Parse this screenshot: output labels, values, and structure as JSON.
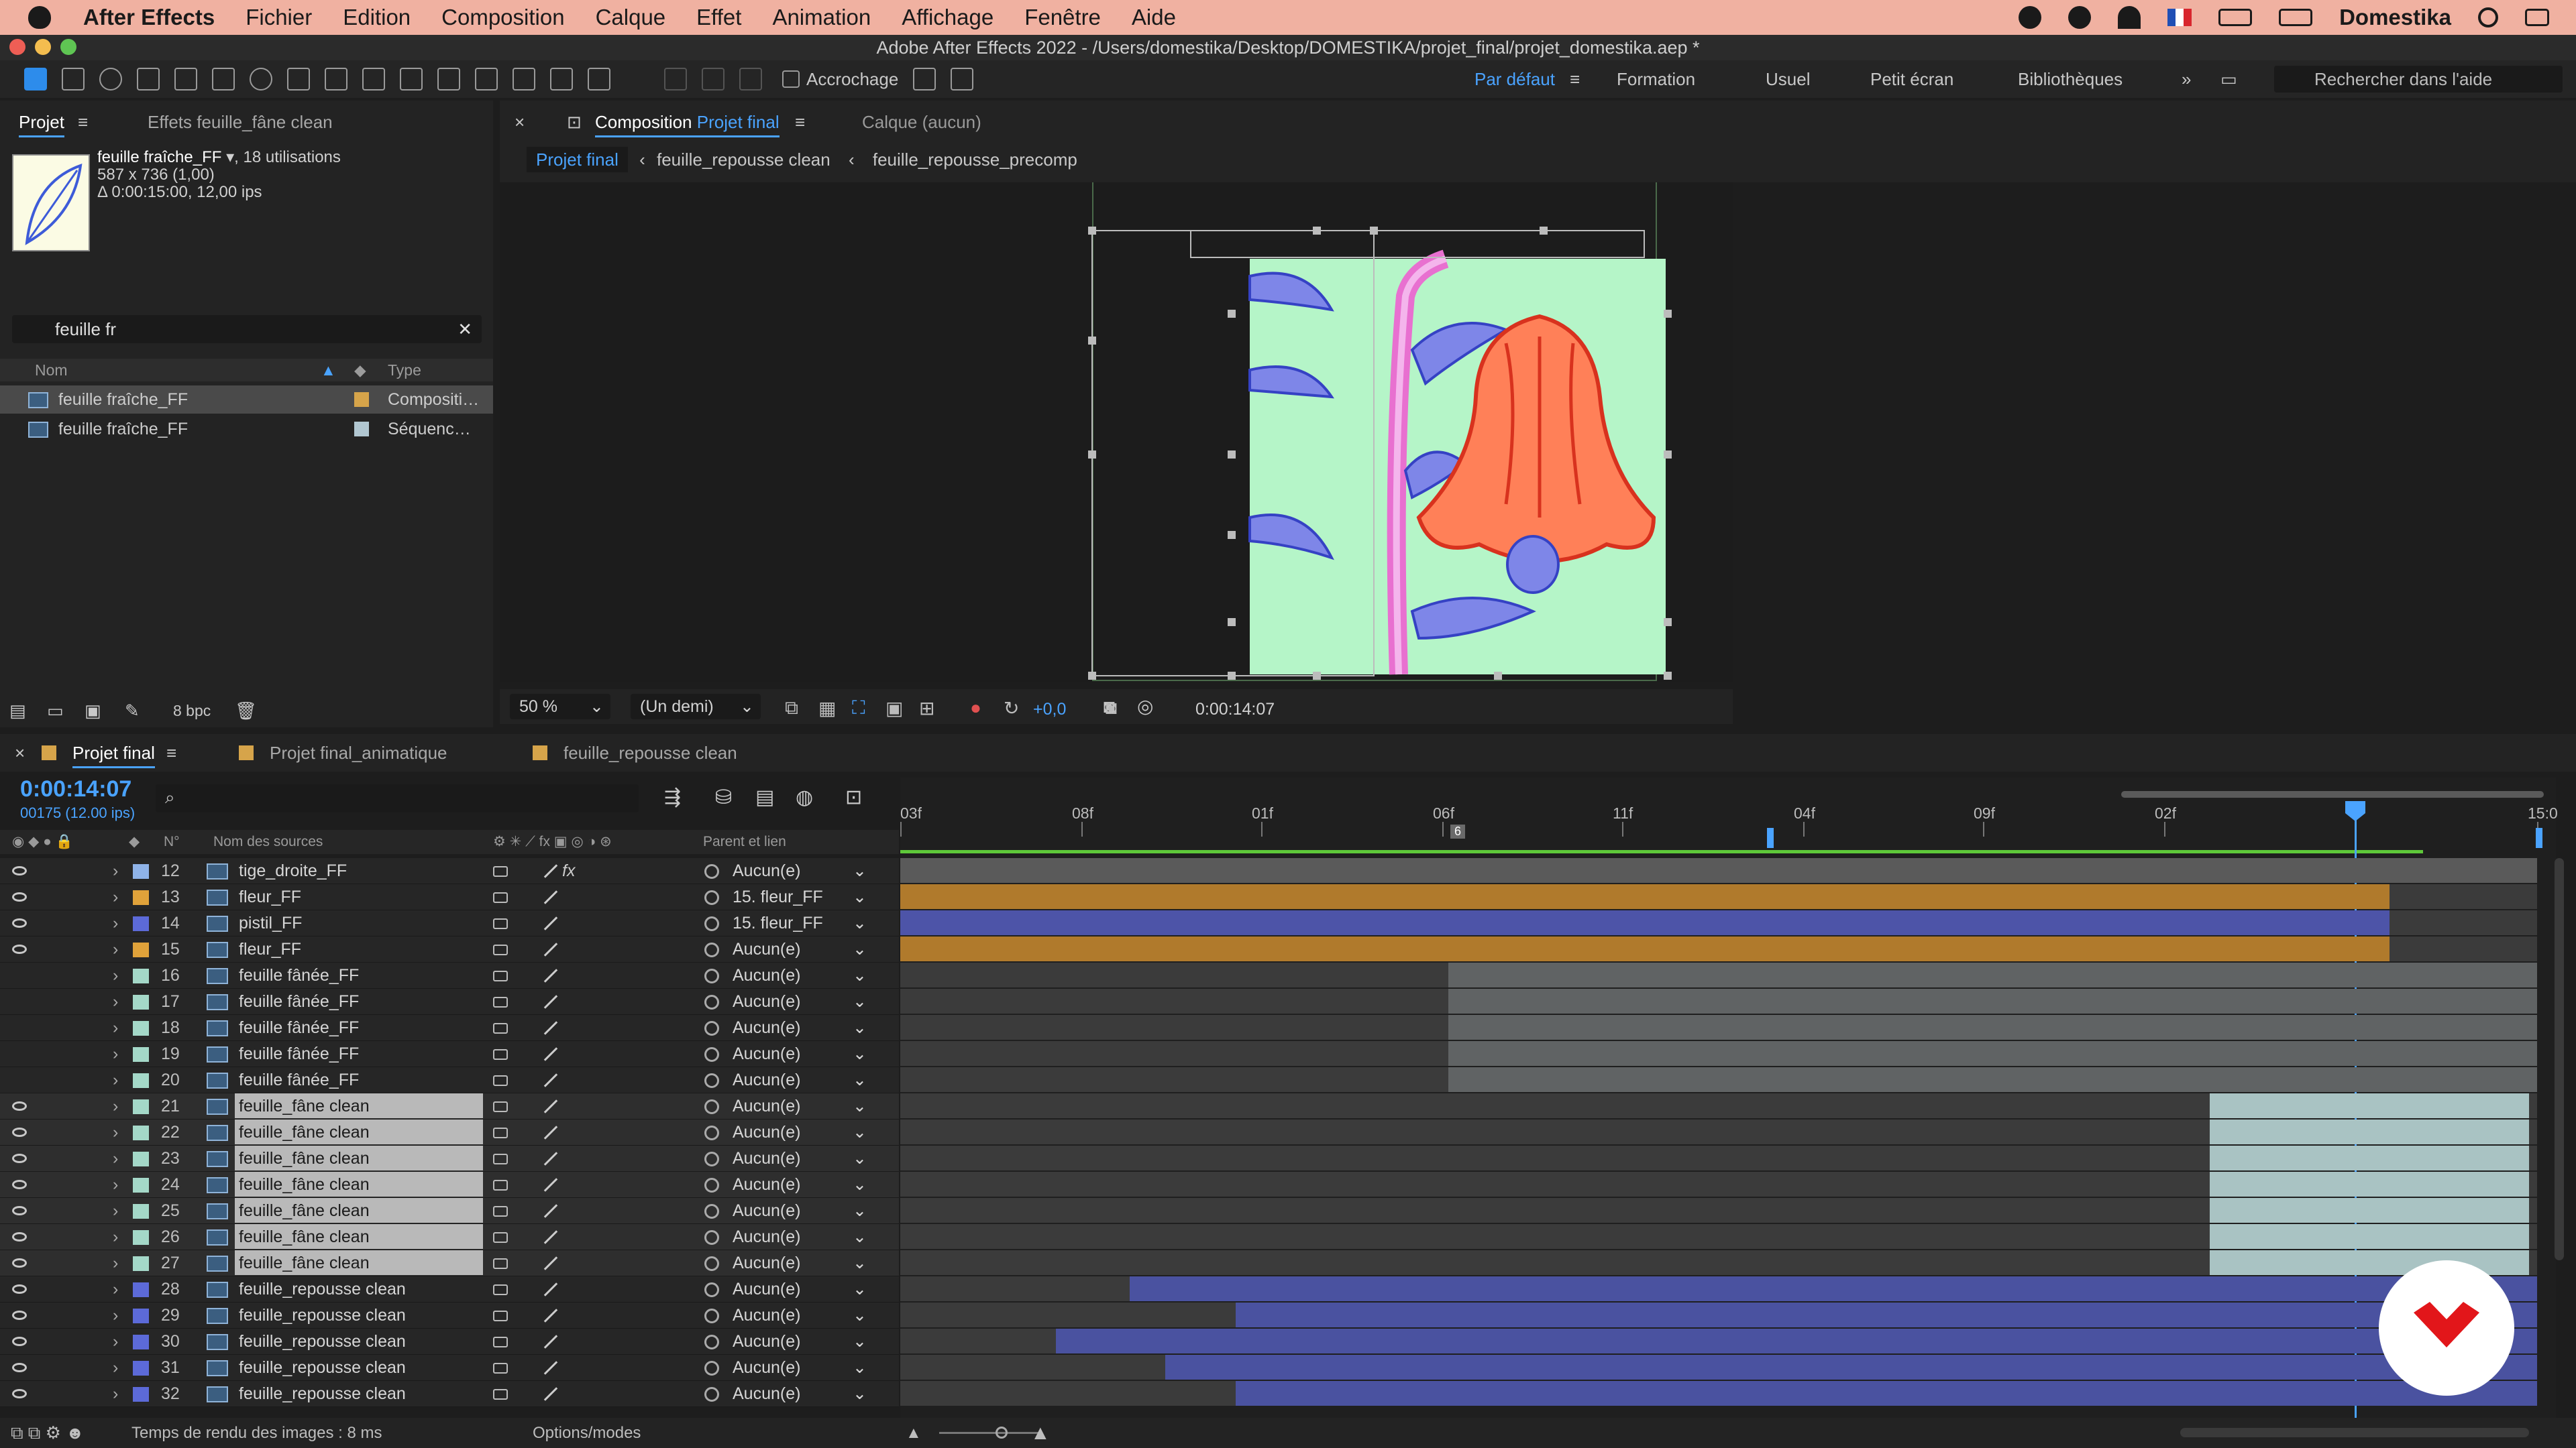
{
  "menubar": {
    "app_name": "After Effects",
    "items": [
      "Fichier",
      "Edition",
      "Composition",
      "Calque",
      "Effet",
      "Animation",
      "Affichage",
      "Fenêtre",
      "Aide"
    ],
    "user": "Domestika"
  },
  "window_title": "Adobe After Effects 2022 - /Users/domestika/Desktop/DOMESTIKA/projet_final/projet_domestika.aep *",
  "toolbar": {
    "snapping_label": "Accrochage",
    "workspaces": [
      "Par défaut",
      "Formation",
      "Usuel",
      "Petit écran",
      "Bibliothèques"
    ],
    "active_workspace": "Par défaut",
    "search_placeholder": "Rechercher dans l'aide"
  },
  "project_panel": {
    "tab_label": "Projet",
    "effects_tab": "Effets",
    "effects_target": "feuille_fâne clean",
    "item_name": "feuille fraîche_FF",
    "item_uses": ", 18 utilisations",
    "item_dims": "587 x 736 (1,00)",
    "item_duration": "Δ 0:00:15:00, 12,00 ips",
    "search_value": "feuille fr",
    "col_name": "Nom",
    "col_type": "Type",
    "rows": [
      {
        "name": "feuille fraîche_FF",
        "type": "Compositi…",
        "label_color": "#d6a44a"
      },
      {
        "name": "feuille fraîche_FF",
        "type": "Séquenc…",
        "label_color": "#b1c7d1"
      }
    ],
    "bpc": "8 bpc"
  },
  "composition_panel": {
    "tab_prefix": "Composition",
    "comp_name": "Projet final",
    "layer_tab": "Calque (aucun)",
    "breadcrumbs": [
      "Projet final",
      "feuille_repousse clean",
      "feuille_repousse_precomp"
    ],
    "zoom": "50 %",
    "resolution": "(Un demi)",
    "exposure": "+0,0",
    "timecode": "0:00:14:07"
  },
  "timeline": {
    "tabs": [
      {
        "label": "Projet final",
        "active": true
      },
      {
        "label": "Projet final_animatique",
        "active": false
      },
      {
        "label": "feuille_repousse clean",
        "active": false
      }
    ],
    "current_time": "0:00:14:07",
    "frame_info": "00175 (12.00 ips)",
    "col_num": "N°",
    "col_source": "Nom des sources",
    "col_parent": "Parent et lien",
    "ruler_ticks": [
      "03f",
      "08f",
      "01f",
      "06f",
      "11f",
      "04f",
      "09f",
      "02f",
      "15:0"
    ],
    "ruler_marker": "6",
    "layers": [
      {
        "num": "12",
        "name": "tige_droite_FF",
        "parent": "Aucun(e)",
        "color": "#8fb3e8",
        "eye": true,
        "sel": false,
        "fx": true,
        "bar_color": "#5a5a5a",
        "start": 0.0,
        "end": 1.0
      },
      {
        "num": "13",
        "name": "fleur_FF",
        "parent": "15. fleur_FF",
        "color": "#e0a23a",
        "eye": true,
        "sel": false,
        "fx": false,
        "bar_color": "#b07a2c",
        "start": 0.0,
        "end": 0.91
      },
      {
        "num": "14",
        "name": "pistil_FF",
        "parent": "15. fleur_FF",
        "color": "#5c6ad8",
        "eye": true,
        "sel": false,
        "fx": false,
        "bar_color": "#4d54a8",
        "start": 0.0,
        "end": 0.91
      },
      {
        "num": "15",
        "name": "fleur_FF",
        "parent": "Aucun(e)",
        "color": "#e0a23a",
        "eye": true,
        "sel": false,
        "fx": false,
        "bar_color": "#b07a2c",
        "start": 0.0,
        "end": 0.91
      },
      {
        "num": "16",
        "name": "feuille fânée_FF",
        "parent": "Aucun(e)",
        "color": "#a4d8c8",
        "eye": false,
        "sel": false,
        "fx": false,
        "bar_color": "#606364",
        "start": 0.335,
        "end": 1.0
      },
      {
        "num": "17",
        "name": "feuille fânée_FF",
        "parent": "Aucun(e)",
        "color": "#a4d8c8",
        "eye": false,
        "sel": false,
        "fx": false,
        "bar_color": "#606364",
        "start": 0.335,
        "end": 1.0
      },
      {
        "num": "18",
        "name": "feuille fânée_FF",
        "parent": "Aucun(e)",
        "color": "#a4d8c8",
        "eye": false,
        "sel": false,
        "fx": false,
        "bar_color": "#606364",
        "start": 0.335,
        "end": 1.0
      },
      {
        "num": "19",
        "name": "feuille fânée_FF",
        "parent": "Aucun(e)",
        "color": "#a4d8c8",
        "eye": false,
        "sel": false,
        "fx": false,
        "bar_color": "#606364",
        "start": 0.335,
        "end": 1.0
      },
      {
        "num": "20",
        "name": "feuille fânée_FF",
        "parent": "Aucun(e)",
        "color": "#a4d8c8",
        "eye": false,
        "sel": false,
        "fx": false,
        "bar_color": "#606364",
        "start": 0.335,
        "end": 1.0
      },
      {
        "num": "21",
        "name": "feuille_fâne clean",
        "parent": "Aucun(e)",
        "color": "#a4d8c8",
        "eye": true,
        "sel": true,
        "fx": false,
        "bar_color": "#a9c3c3",
        "start": 0.8,
        "end": 0.995
      },
      {
        "num": "22",
        "name": "feuille_fâne clean",
        "parent": "Aucun(e)",
        "color": "#a4d8c8",
        "eye": true,
        "sel": true,
        "fx": false,
        "bar_color": "#a9c3c3",
        "start": 0.8,
        "end": 0.995
      },
      {
        "num": "23",
        "name": "feuille_fâne clean",
        "parent": "Aucun(e)",
        "color": "#a4d8c8",
        "eye": true,
        "sel": true,
        "fx": false,
        "bar_color": "#a9c3c3",
        "start": 0.8,
        "end": 0.995
      },
      {
        "num": "24",
        "name": "feuille_fâne clean",
        "parent": "Aucun(e)",
        "color": "#a4d8c8",
        "eye": true,
        "sel": true,
        "fx": false,
        "bar_color": "#a9c3c3",
        "start": 0.8,
        "end": 0.995
      },
      {
        "num": "25",
        "name": "feuille_fâne clean",
        "parent": "Aucun(e)",
        "color": "#a4d8c8",
        "eye": true,
        "sel": true,
        "fx": false,
        "bar_color": "#a9c3c3",
        "start": 0.8,
        "end": 0.995
      },
      {
        "num": "26",
        "name": "feuille_fâne clean",
        "parent": "Aucun(e)",
        "color": "#a4d8c8",
        "eye": true,
        "sel": true,
        "fx": false,
        "bar_color": "#a9c3c3",
        "start": 0.8,
        "end": 0.995
      },
      {
        "num": "27",
        "name": "feuille_fâne clean",
        "parent": "Aucun(e)",
        "color": "#a4d8c8",
        "eye": true,
        "sel": true,
        "fx": false,
        "bar_color": "#a9c3c3",
        "start": 0.8,
        "end": 0.995
      },
      {
        "num": "28",
        "name": "feuille_repousse clean",
        "parent": "Aucun(e)",
        "color": "#5c6ad8",
        "eye": true,
        "sel": false,
        "fx": false,
        "bar_color": "#4a52a0",
        "start": 0.14,
        "end": 1.0
      },
      {
        "num": "29",
        "name": "feuille_repousse clean",
        "parent": "Aucun(e)",
        "color": "#5c6ad8",
        "eye": true,
        "sel": false,
        "fx": false,
        "bar_color": "#4a52a0",
        "start": 0.205,
        "end": 1.0
      },
      {
        "num": "30",
        "name": "feuille_repousse clean",
        "parent": "Aucun(e)",
        "color": "#5c6ad8",
        "eye": true,
        "sel": false,
        "fx": false,
        "bar_color": "#4a52a0",
        "start": 0.095,
        "end": 1.0
      },
      {
        "num": "31",
        "name": "feuille_repousse clean",
        "parent": "Aucun(e)",
        "color": "#5c6ad8",
        "eye": true,
        "sel": false,
        "fx": false,
        "bar_color": "#4a52a0",
        "start": 0.162,
        "end": 1.0
      },
      {
        "num": "32",
        "name": "feuille_repousse clean",
        "parent": "Aucun(e)",
        "color": "#5c6ad8",
        "eye": true,
        "sel": false,
        "fx": false,
        "bar_color": "#4a52a0",
        "start": 0.205,
        "end": 1.0
      }
    ]
  },
  "status": {
    "render_time": "Temps de rendu des images : 8 ms",
    "options": "Options/modes"
  }
}
